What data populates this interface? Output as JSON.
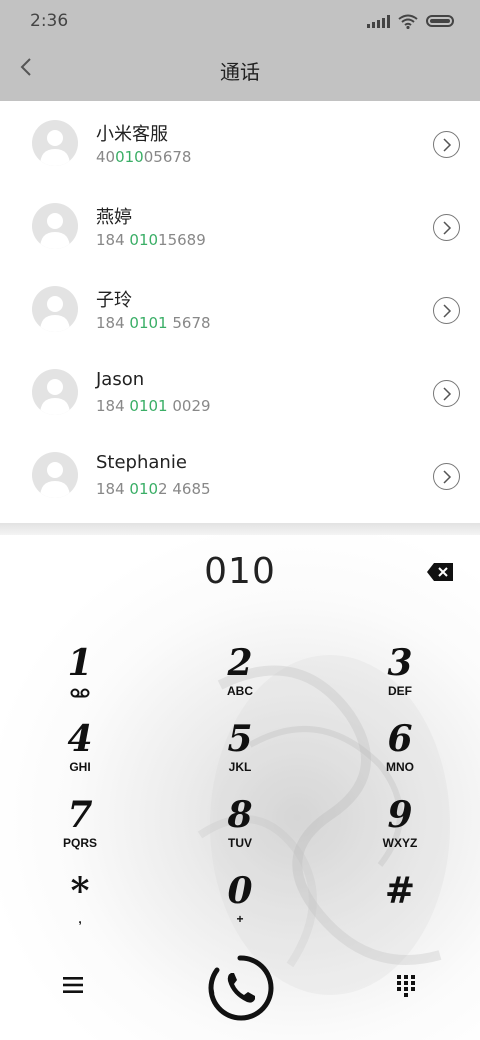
{
  "status": {
    "time": "2:36"
  },
  "header": {
    "title": "通话"
  },
  "contacts": [
    {
      "name": "小米客服",
      "num_pre": "40",
      "num_hl": "010",
      "num_post": "05678"
    },
    {
      "name": "燕婷",
      "num_pre": "184 ",
      "num_hl": "010",
      "num_post": "15689"
    },
    {
      "name": "子玲",
      "num_pre": "184 ",
      "num_hl": "0101",
      "num_post": " 5678"
    },
    {
      "name": "Jason",
      "num_pre": "184 ",
      "num_hl": "0101",
      "num_post": " 0029"
    },
    {
      "name": "Stephanie",
      "num_pre": "184 ",
      "num_hl": "010",
      "num_post": "2 4685"
    }
  ],
  "dialer": {
    "input": "010",
    "keys": [
      {
        "digit": "1",
        "letters": ""
      },
      {
        "digit": "2",
        "letters": "ABC"
      },
      {
        "digit": "3",
        "letters": "DEF"
      },
      {
        "digit": "4",
        "letters": "GHI"
      },
      {
        "digit": "5",
        "letters": "JKL"
      },
      {
        "digit": "6",
        "letters": "MNO"
      },
      {
        "digit": "7",
        "letters": "PQRS"
      },
      {
        "digit": "8",
        "letters": "TUV"
      },
      {
        "digit": "9",
        "letters": "WXYZ"
      },
      {
        "digit": "*",
        "letters": ","
      },
      {
        "digit": "0",
        "letters": "+"
      },
      {
        "digit": "#",
        "letters": ""
      }
    ]
  },
  "colors": {
    "highlight": "#3aae66",
    "header_bg": "#c2c2c2"
  }
}
